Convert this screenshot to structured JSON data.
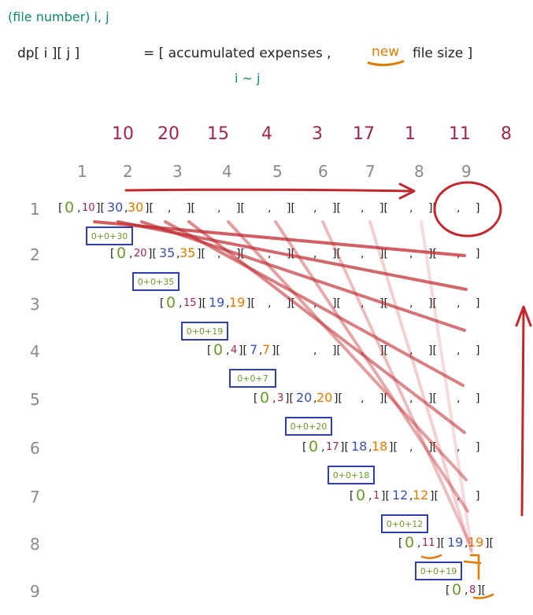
{
  "header": {
    "note": "(file number) i, j",
    "dp_label": "dp[ i ][ j ]",
    "equals_text": "= [ accumulated expenses ,",
    "new_word": "new",
    "file_size": "file size ]",
    "range": "i ~ j"
  },
  "file_sizes": [
    "10",
    "20",
    "15",
    "4",
    "3",
    "17",
    "1",
    "11",
    "8"
  ],
  "col_indices": [
    "1",
    "2",
    "3",
    "4",
    "5",
    "6",
    "7",
    "8",
    "9"
  ],
  "row_indices": [
    "1",
    "2",
    "3",
    "4",
    "5",
    "6",
    "7",
    "8",
    "9"
  ],
  "rows": [
    {
      "zero": "0",
      "size": "10",
      "next": "30",
      "next2": "30"
    },
    {
      "zero": "0",
      "size": "20",
      "next": "35",
      "next2": "35"
    },
    {
      "zero": "0",
      "size": "15",
      "next": "19",
      "next2": "19"
    },
    {
      "zero": "0",
      "size": "4",
      "next": "7",
      "next2": "7"
    },
    {
      "zero": "0",
      "size": "3",
      "next": "20",
      "next2": "20"
    },
    {
      "zero": "0",
      "size": "17",
      "next": "18",
      "next2": "18"
    },
    {
      "zero": "0",
      "size": "1",
      "next": "12",
      "next2": "12"
    },
    {
      "zero": "0",
      "size": "11",
      "next": "19",
      "next2": "19"
    },
    {
      "zero": "0",
      "size": "8"
    }
  ],
  "sum_boxes": [
    "0+0+30",
    "0+0+35",
    "0+0+19",
    "0+0+7",
    "0+0+20",
    "0+0+18",
    "0+0+12",
    "0+0+19"
  ],
  "colors": {
    "maroon": "#a0264a",
    "teal": "#0f8a6a",
    "orange": "#e07b00",
    "green": "#6a9a2a",
    "blue": "#3a4fb5",
    "red_arrow": "#c0282d",
    "box_border": "#2f3fb0"
  }
}
